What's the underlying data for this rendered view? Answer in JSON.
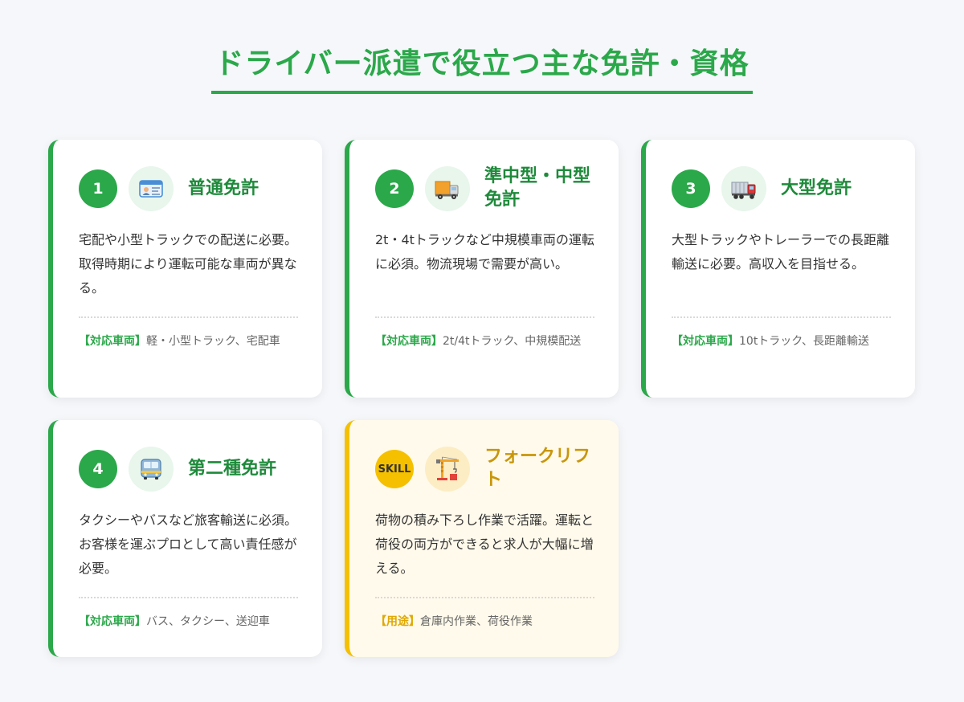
{
  "page": {
    "title": "ドライバー派遣で役立つ主な免許・資格"
  },
  "colors": {
    "accent": "#2ba84a",
    "accent_dark": "#1f8a3b",
    "skill_accent": "#f5c000",
    "skill_text": "#c8960a",
    "background": "#f5f7fa"
  },
  "cards": [
    {
      "badge": "1",
      "icon": "id-card-icon",
      "title": "普通免許",
      "description": "宅配や小型トラックでの配送に必要。取得時期により運転可能な車両が異なる。",
      "meta_label": "【対応車両】",
      "meta_value": "軽・小型トラック、宅配車"
    },
    {
      "badge": "2",
      "icon": "delivery-truck-icon",
      "title": "準中型・中型免許",
      "description": "2t・4tトラックなど中規模車両の運転に必須。物流現場で需要が高い。",
      "meta_label": "【対応車両】",
      "meta_value": "2t/4tトラック、中規模配送"
    },
    {
      "badge": "3",
      "icon": "semi-truck-icon",
      "title": "大型免許",
      "description": "大型トラックやトレーラーでの長距離輸送に必要。高収入を目指せる。",
      "meta_label": "【対応車両】",
      "meta_value": "10tトラック、長距離輸送"
    },
    {
      "badge": "4",
      "icon": "bus-icon",
      "title": "第二種免許",
      "description": "タクシーやバスなど旅客輸送に必須。お客様を運ぶプロとして高い責任感が必要。",
      "meta_label": "【対応車両】",
      "meta_value": "バス、タクシー、送迎車"
    },
    {
      "badge": "SKILL",
      "icon": "crane-icon",
      "title": "フォークリフト",
      "description": "荷物の積み下ろし作業で活躍。運転と荷役の両方ができると求人が大幅に増える。",
      "meta_label": "【用途】",
      "meta_value": "倉庫内作業、荷役作業"
    }
  ]
}
